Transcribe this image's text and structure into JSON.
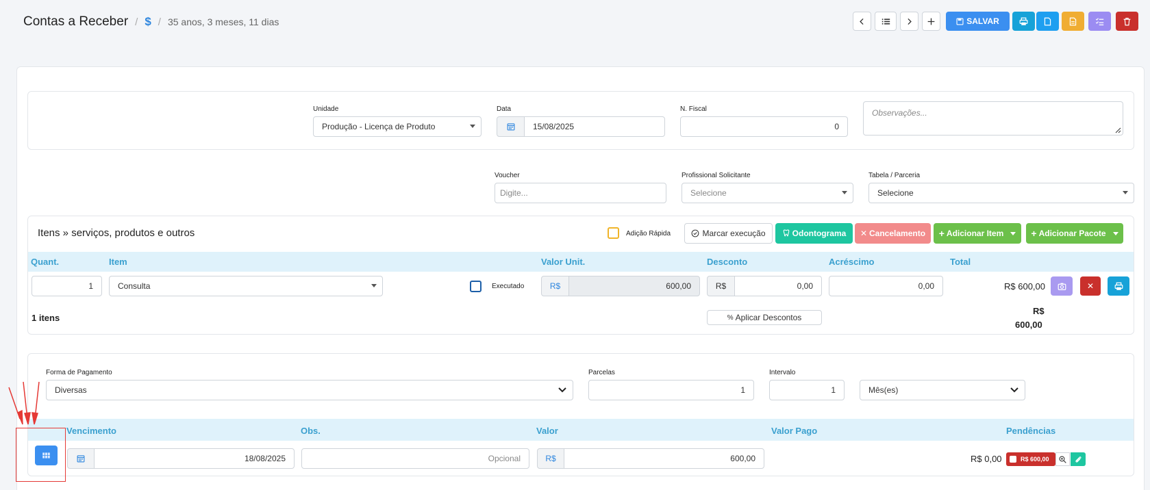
{
  "header": {
    "title": "Contas a Receber",
    "currency_symbol": "$",
    "age": "35 anos, 3 meses, 11 dias"
  },
  "toolbar": {
    "save_label": "SALVAR",
    "colors": {
      "save": "#3b8ff0",
      "print": "#17a2d8",
      "doc": "#1e9ff0",
      "file": "#f0ad32",
      "list": "#9b8cf2",
      "delete": "#c9302c"
    }
  },
  "form": {
    "unidade_label": "Unidade",
    "unidade_value": "Produção - Licença de Produto",
    "data_label": "Data",
    "data_value": "15/08/2025",
    "nfiscal_label": "N. Fiscal",
    "nfiscal_value": "0",
    "observacoes_placeholder": "Observações...",
    "voucher_label": "Voucher",
    "voucher_placeholder": "Digite...",
    "profissional_label": "Profissional Solicitante",
    "profissional_placeholder": "Selecione",
    "tabela_label": "Tabela / Parceria",
    "tabela_value": "Selecione"
  },
  "items": {
    "title": "Itens » serviços, produtos e outros",
    "quick_add_label": "Adição Rápida",
    "mark_exec_label": "Marcar execução",
    "odontograma_label": "Odontograma",
    "cancelamento_label": "Cancelamento",
    "add_item_label": "Adicionar Item",
    "add_package_label": "Adicionar Pacote",
    "columns": [
      "Quant.",
      "Item",
      "Valor Unit.",
      "Desconto",
      "Acréscimo",
      "Total"
    ],
    "row": {
      "quantity": "1",
      "item": "Consulta",
      "executed_label": "Executado",
      "currency": "R$",
      "unit_value": "600,00",
      "discount": "0,00",
      "addition": "0,00",
      "total": "R$ 600,00"
    },
    "count_label": "1 itens",
    "apply_discounts_label": "Aplicar Descontos",
    "grand_total_currency": "R$",
    "grand_total_value": "600,00"
  },
  "payment": {
    "forma_label": "Forma de Pagamento",
    "forma_value": "Diversas",
    "parcelas_label": "Parcelas",
    "parcelas_value": "1",
    "intervalo_label": "Intervalo",
    "intervalo_value": "1",
    "periodo_value": "Mês(es)",
    "columns": [
      "Vencimento",
      "Obs.",
      "Valor",
      "Valor Pago",
      "Pendências"
    ],
    "row": {
      "due_date": "18/08/2025",
      "obs_placeholder": "Opcional",
      "currency": "R$",
      "value": "600,00",
      "paid": "R$ 0,00",
      "pending_badge": "R$ 600,00"
    }
  }
}
